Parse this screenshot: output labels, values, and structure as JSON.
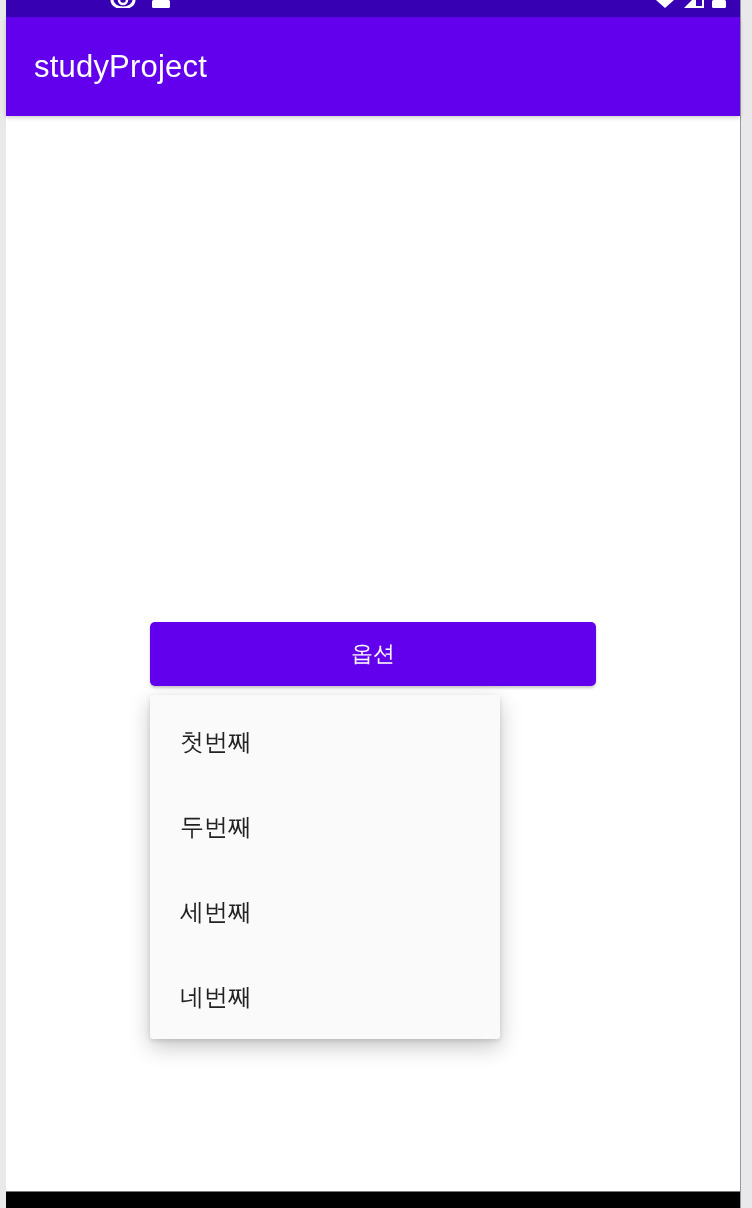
{
  "app_bar": {
    "title": "studyProject"
  },
  "button": {
    "label": "옵션"
  },
  "menu": {
    "items": [
      {
        "label": "첫번째"
      },
      {
        "label": "두번째"
      },
      {
        "label": "세번째"
      },
      {
        "label": "네번째"
      }
    ]
  }
}
